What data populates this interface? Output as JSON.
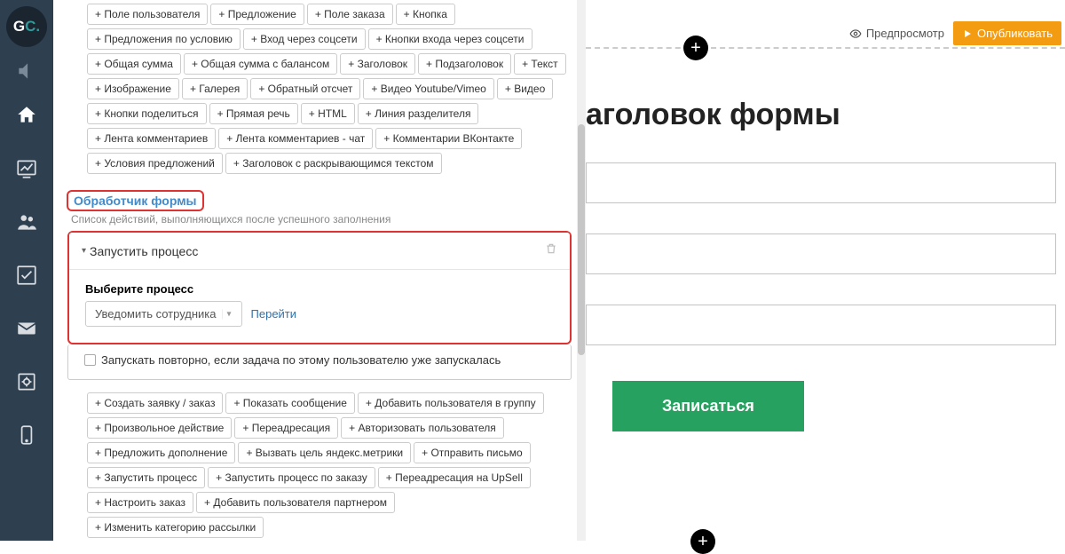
{
  "logo": {
    "g": "G",
    "c": "C",
    "dot": "."
  },
  "tag_rows_top": [
    [
      "+ Поле пользователя",
      "+ Предложение",
      "+ Поле заказа",
      "+ Кнопка"
    ],
    [
      "+ Предложения по условию",
      "+ Вход через соцсети",
      "+ Кнопки входа через соцсети"
    ],
    [
      "+ Общая сумма",
      "+ Общая сумма с балансом",
      "+ Заголовок",
      "+ Подзаголовок",
      "+ Текст"
    ],
    [
      "+ Изображение",
      "+ Галерея",
      "+ Обратный отсчет",
      "+ Видео Youtube/Vimeo",
      "+ Видео"
    ],
    [
      "+ Кнопки поделиться",
      "+ Прямая речь",
      "+ HTML",
      "+ Линия разделителя"
    ],
    [
      "+ Лента комментариев",
      "+ Лента комментариев - чат",
      "+ Комментарии ВКонтакте"
    ],
    [
      "+ Условия предложений",
      "+ Заголовок с раскрывающимся текстом"
    ]
  ],
  "handler": {
    "title": "Обработчик формы",
    "subtitle": "Список действий, выполняющихся после успешного заполнения",
    "action_title": "Запустить процесс",
    "select_label": "Выберите процесс",
    "select_value": "Уведомить сотрудника",
    "go": "Перейти",
    "checkbox": "Запускать повторно, если задача по этому пользователю уже запускалась"
  },
  "tag_rows_bottom": [
    [
      "+ Создать заявку / заказ",
      "+ Показать сообщение",
      "+ Добавить пользователя в группу"
    ],
    [
      "+ Произвольное действие",
      "+ Переадресация",
      "+ Авторизовать пользователя"
    ],
    [
      "+ Предложить дополнение",
      "+ Вызвать цель яндекс.метрики",
      "+ Отправить письмо"
    ],
    [
      "+ Запустить процесс",
      "+ Запустить процесс по заказу",
      "+ Переадресация на UpSell"
    ],
    [
      "+ Настроить заказ",
      "+ Добавить пользователя партнером"
    ],
    [
      "+ Изменить категорию рассылки"
    ]
  ],
  "preview": {
    "preview_btn": "Предпросмотр",
    "publish_btn": "Опубликовать",
    "form_title": "аголовок формы",
    "submit": "Записаться"
  }
}
